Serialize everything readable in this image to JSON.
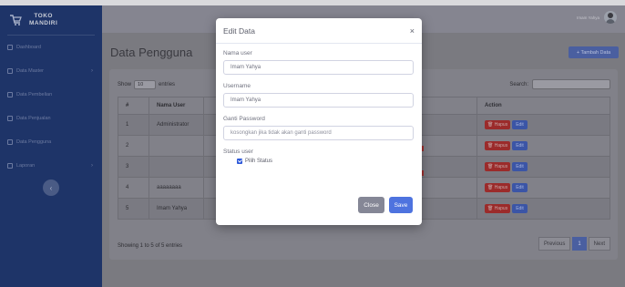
{
  "brand": {
    "line1": "TOKO",
    "line2": "MANDIRI"
  },
  "sidebar": {
    "items": [
      {
        "label": "Dashboard",
        "chevron": ""
      },
      {
        "label": "Data Master",
        "chevron": "›"
      },
      {
        "label": "Data Pembelian",
        "chevron": ""
      },
      {
        "label": "Data Penjualan",
        "chevron": ""
      },
      {
        "label": "Data Pengguna",
        "chevron": ""
      },
      {
        "label": "Laporan",
        "chevron": "›"
      }
    ],
    "toggle": "‹"
  },
  "topbar": {
    "user_name": "Imam Yahya"
  },
  "page": {
    "title": "Data Pengguna",
    "add_button": "+ Tambah Data"
  },
  "table": {
    "show_label": "Show",
    "entries_value": "10",
    "entries_label": "entries",
    "search_label": "Search:",
    "headers": [
      "#",
      "Nama User",
      "",
      "",
      "Action"
    ],
    "rows": [
      {
        "no": "1",
        "nama": "Administrator"
      },
      {
        "no": "2",
        "nama": ""
      },
      {
        "no": "3",
        "nama": ""
      },
      {
        "no": "4",
        "nama": "aaaaaaaa"
      },
      {
        "no": "5",
        "nama": "Imam Yahya"
      }
    ],
    "hapus_label": "Hapus",
    "edit_label": "Edit",
    "info": "Showing 1 to 5 of 5 entries",
    "pager": {
      "previous": "Previous",
      "current": "1",
      "next": "Next"
    }
  },
  "modal": {
    "title": "Edit Data",
    "close_symbol": "×",
    "nama_label": "Nama user",
    "nama_value": "Imam Yahya",
    "username_label": "Username",
    "username_value": "Imam Yahya",
    "password_label": "Ganti Password",
    "password_placeholder": "kosongkan jika tidak akan ganti password",
    "status_label": "Status user",
    "status_checkbox_label": "Pilih Status",
    "close_button": "Close",
    "save_button": "Save"
  },
  "colors": {
    "primary": "#4e73df",
    "secondary": "#858796",
    "danger": "#9b2b2b",
    "sidebar": "#1e3468"
  }
}
